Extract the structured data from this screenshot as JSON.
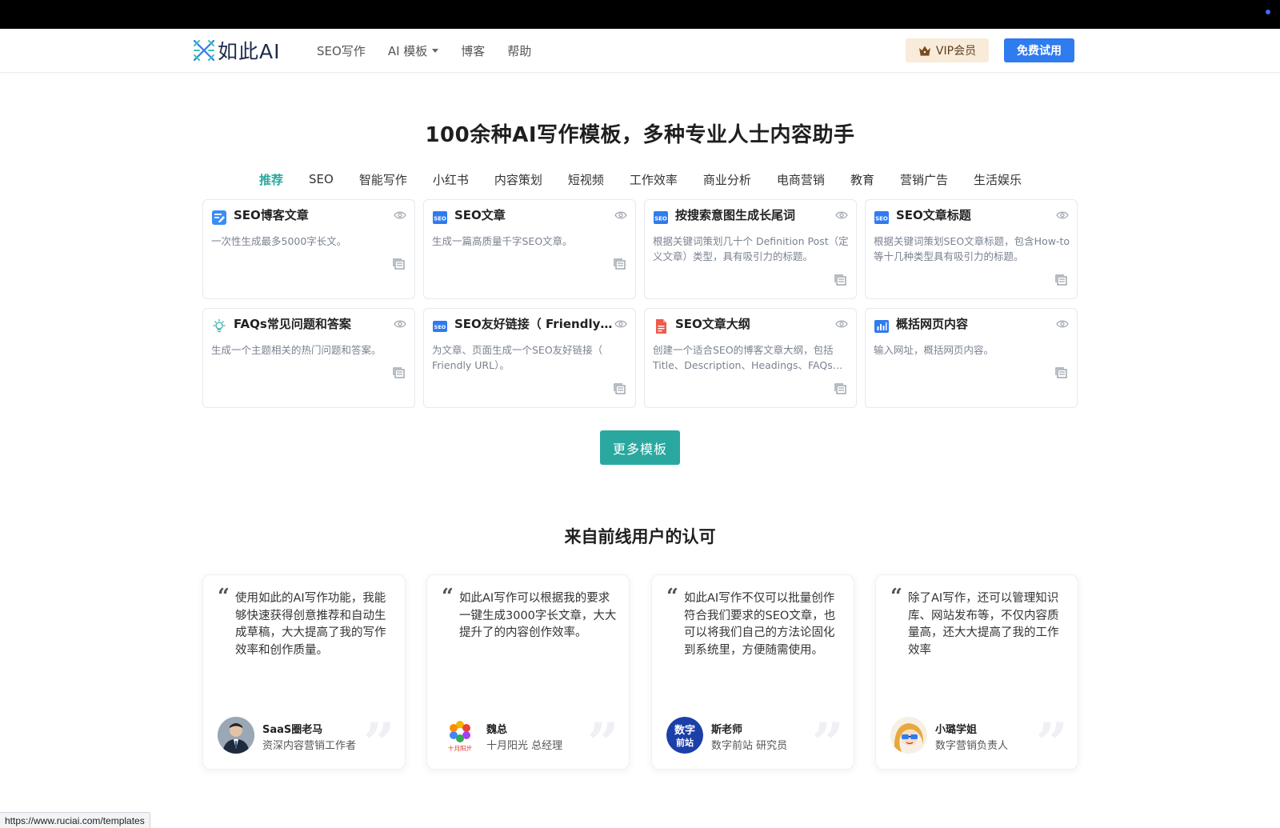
{
  "header": {
    "logo_text": "如此AI",
    "menu": [
      {
        "label": "SEO写作",
        "has_caret": false
      },
      {
        "label": "AI 模板",
        "has_caret": true
      },
      {
        "label": "博客",
        "has_caret": false
      },
      {
        "label": "帮助",
        "has_caret": false
      }
    ],
    "vip_label": "VIP会员",
    "trial_label": "免费试用"
  },
  "hero": {
    "title": "100余种AI写作模板，多种专业人士内容助手"
  },
  "categories": [
    "推荐",
    "SEO",
    "智能写作",
    "小红书",
    "内容策划",
    "短视频",
    "工作效率",
    "商业分析",
    "电商营销",
    "教育",
    "营销广告",
    "生活娱乐"
  ],
  "active_category": "推荐",
  "templates": [
    {
      "icon": "edit-note-icon",
      "title": "SEO博客文章",
      "desc": "一次性生成最多5000字长文。"
    },
    {
      "icon": "seo-badge-icon",
      "title": "SEO文章",
      "desc": "生成一篇高质量千字SEO文章。"
    },
    {
      "icon": "seo-badge-icon",
      "title": "按搜索意图生成长尾词",
      "desc": "根据关键词策划几十个 Definition Post（定义文章）类型，具有吸引力的标题。"
    },
    {
      "icon": "seo-badge-icon",
      "title": "SEO文章标题",
      "desc": "根据关键词策划SEO文章标题，包含How-to等十几种类型具有吸引力的标题。"
    },
    {
      "icon": "lightbulb-icon",
      "title": "FAQs常见问题和答案",
      "desc": "生成一个主题相关的热门问题和答案。"
    },
    {
      "icon": "seo-badge-icon",
      "title": "SEO友好链接（ Friendly URL）",
      "desc": "为文章、页面生成一个SEO友好链接（ Friendly URL）。"
    },
    {
      "icon": "document-icon",
      "title": "SEO文章大纲",
      "desc": "创建一个适合SEO的博客文章大纲，包括Title、Description、Headings、FAQs、Conclusion等部分。"
    },
    {
      "icon": "bar-chart-icon",
      "title": "概括网页内容",
      "desc": "输入网址，概括网页内容。"
    }
  ],
  "more_label": "更多模板",
  "testimonials_title": "来自前线用户的认可",
  "testimonials": [
    {
      "quote": "使用如此的AI写作功能，我能够快速获得创意推荐和自动生成草稿，大大提高了我的写作效率和创作质量。",
      "name": "SaaS圈老马",
      "role": "资深内容营销工作者",
      "avatar": "person-avatar"
    },
    {
      "quote": "如此AI写作可以根据我的要求一键生成3000字长文章，大大提升了的内容创作效率。",
      "name": "魏总",
      "role": "十月阳光 总经理",
      "avatar": "flower-logo-avatar",
      "logo_caption": "十月阳光"
    },
    {
      "quote": "如此AI写作不仅可以批量创作符合我们要求的SEO文章，也可以将我们自己的方法论固化到系统里，方便随需使用。",
      "name": "斯老师",
      "role": "数字前站 研究员",
      "avatar": "text-logo-avatar",
      "logo_line1": "数字",
      "logo_line2": "前站"
    },
    {
      "quote": "除了AI写作，还可以管理知识库、网站发布等，不仅内容质量高，还大大提高了我的工作效率",
      "name": "小璐学姐",
      "role": "数字营销负责人",
      "avatar": "illustrated-avatar"
    }
  ],
  "status_url": "https://www.ruciai.com/templates",
  "colors": {
    "accent": "#2aa8a0",
    "primary": "#2f7bf0",
    "vip_bg": "#f9ebd9"
  }
}
